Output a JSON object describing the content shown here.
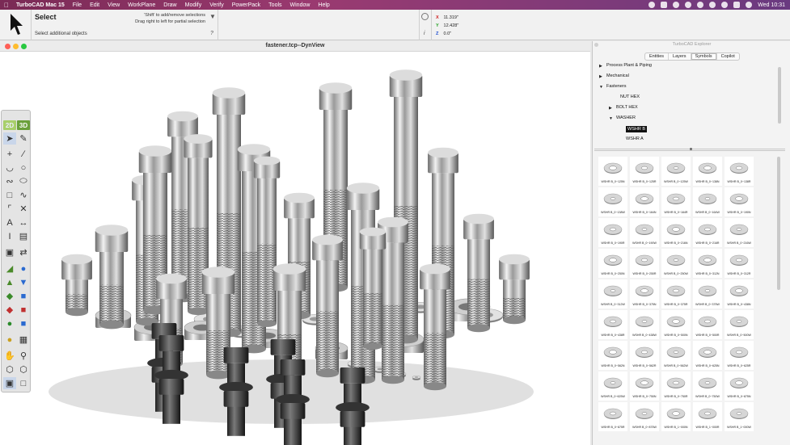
{
  "menubar": {
    "app": "TurboCAD Mac 15",
    "items": [
      "File",
      "Edit",
      "View",
      "WorkPlane",
      "Draw",
      "Modify",
      "Verify",
      "PowerPack",
      "Tools",
      "Window",
      "Help"
    ],
    "clock": "Wed 10:31"
  },
  "inspector": {
    "tool_title": "Select",
    "tool_hint": "Select additional objects",
    "hint_line1": "'Shift' to add/remove selections",
    "hint_line2": "Drag right to left for partial selection",
    "coords": [
      {
        "label": "X",
        "value": "11.319\""
      },
      {
        "label": "Y",
        "value": "12.428\""
      },
      {
        "label": "Z",
        "value": "0.0\""
      }
    ]
  },
  "document": {
    "title": "fastener.tcp--DynView"
  },
  "palette": {
    "mode_2d": "2D",
    "mode_3d": "3D"
  },
  "explorer": {
    "title": "TurboCAD Explorer",
    "tabs": [
      "Entities",
      "Layers",
      "Symbols",
      "Copilot"
    ],
    "active_tab": "Symbols",
    "tree": [
      {
        "label": "Process Plant & Piping",
        "level": 0,
        "state": "collapsed"
      },
      {
        "label": "Mechanical",
        "level": 0,
        "state": "collapsed"
      },
      {
        "label": "Fasteners",
        "level": 0,
        "state": "expanded"
      },
      {
        "label": "NUT HEX",
        "level": 1,
        "state": "leaf"
      },
      {
        "label": "BOLT HEX",
        "level": 1,
        "state": "collapsed"
      },
      {
        "label": "WASHER",
        "level": 1,
        "state": "expanded"
      },
      {
        "label": "WSHR B",
        "level": 2,
        "state": "selected"
      },
      {
        "label": "WSHR A",
        "level": 2,
        "state": "leaf"
      }
    ],
    "symbols": [
      "WSHR B_0~125N",
      "WSHR B_0~125R",
      "WSHR B_0~125W",
      "WSHR B_0~138N",
      "WSHR B_0~138R",
      "WSHR B_0~138W",
      "WSHR B_0~164N",
      "WSHR B_0~164R",
      "WSHR B_0~164W",
      "WSHR B_0~190N",
      "WSHR B_0~190R",
      "WSHR B_0~190W",
      "WSHR B_0~216N",
      "WSHR B_0~216R",
      "WSHR B_0~216W",
      "WSHR B_0~250N",
      "WSHR B_0~250R",
      "WSHR B_0~250W",
      "WSHR B_0~312N",
      "WSHR B_0~312R",
      "WSHR B_0~312W",
      "WSHR B_0~375N",
      "WSHR B_0~375R",
      "WSHR B_0~375W",
      "WSHR B_0~438N",
      "WSHR B_0~438R",
      "WSHR B_0~438W",
      "WSHR B_0~500N",
      "WSHR B_0~500R",
      "WSHR B_0~500W",
      "WSHR B_0~562N",
      "WSHR B_0~562R",
      "WSHR B_0~562W",
      "WSHR B_0~625N",
      "WSHR B_0~625R",
      "WSHR B_0~625W",
      "WSHR B_0~750N",
      "WSHR B_0~750R",
      "WSHR B_0~750W",
      "WSHR B_0~875N",
      "WSHR B_0~875R",
      "WSHR B_0~875W",
      "WSHR B_1~000N",
      "WSHR B_1~000R",
      "WSHR B_1~000W"
    ]
  },
  "colors": {
    "menubar": "#8a3366",
    "selection": "#111111",
    "mode_3d": "#6aa03a",
    "close": "#ff5f57",
    "minimize": "#febc2e",
    "zoom": "#28c840"
  }
}
